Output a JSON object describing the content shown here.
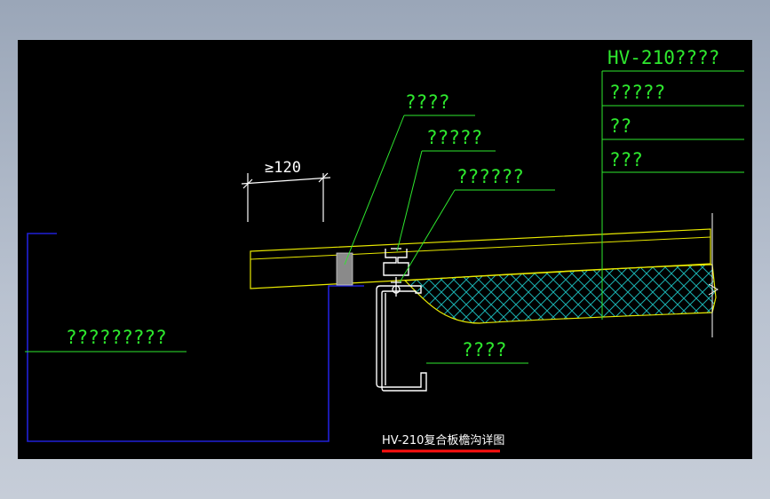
{
  "drawing": {
    "title": "HV-210复合板檐沟详图",
    "dimension": "≥120",
    "labels": {
      "table_header": "HV-210????",
      "table_row_1": "?????",
      "table_row_2": "??",
      "table_row_3": "???",
      "callout_1": "????",
      "callout_2": "?????",
      "callout_3": "??????",
      "callout_purlin": "????",
      "callout_gutter": "?????????"
    }
  },
  "colors": {
    "canvas": "#000000",
    "annotation": "#2ee82e",
    "roof_panel": "#e8e800",
    "gutter_outline": "#2020d8",
    "steel_member": "#ffffff",
    "insulation_hatch": "#1ab0b0",
    "title_underline": "#ff1010"
  }
}
